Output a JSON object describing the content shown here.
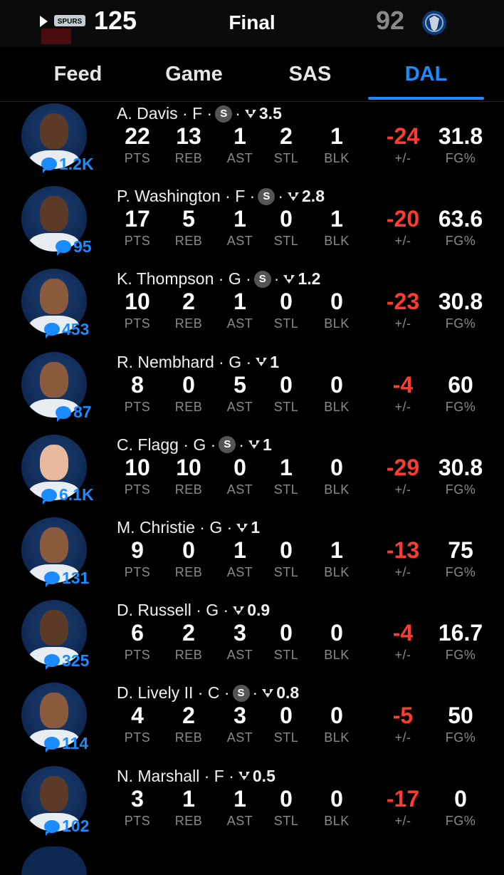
{
  "header": {
    "away_team": "SAS",
    "away_score": "125",
    "status": "Final",
    "home_score": "92",
    "home_team": "DAL",
    "spurs_logo_text": "SPURS"
  },
  "tabs": [
    {
      "label": "Feed",
      "active": false
    },
    {
      "label": "Game",
      "active": false
    },
    {
      "label": "SAS",
      "active": false
    },
    {
      "label": "DAL",
      "active": true
    }
  ],
  "stat_labels": [
    "PTS",
    "REB",
    "AST",
    "STL",
    "BLK",
    "+/-",
    "FG%"
  ],
  "players": [
    {
      "name": "A. Davis",
      "pos": "F",
      "starter": true,
      "rating": "3.5",
      "comments": "1.2K",
      "pts": "22",
      "reb": "13",
      "ast": "1",
      "stl": "2",
      "blk": "1",
      "pm": "-24",
      "fg": "31.8",
      "skin": "dark"
    },
    {
      "name": "P. Washington",
      "pos": "F",
      "starter": true,
      "rating": "2.8",
      "comments": "95",
      "pts": "17",
      "reb": "5",
      "ast": "1",
      "stl": "0",
      "blk": "1",
      "pm": "-20",
      "fg": "63.6",
      "skin": "dark"
    },
    {
      "name": "K. Thompson",
      "pos": "G",
      "starter": true,
      "rating": "1.2",
      "comments": "453",
      "pts": "10",
      "reb": "2",
      "ast": "1",
      "stl": "0",
      "blk": "0",
      "pm": "-23",
      "fg": "30.8",
      "skin": "mid"
    },
    {
      "name": "R. Nembhard",
      "pos": "G",
      "starter": false,
      "rating": "1",
      "comments": "87",
      "pts": "8",
      "reb": "0",
      "ast": "5",
      "stl": "0",
      "blk": "0",
      "pm": "-4",
      "fg": "60",
      "skin": "mid"
    },
    {
      "name": "C. Flagg",
      "pos": "G",
      "starter": true,
      "rating": "1",
      "comments": "6.1K",
      "pts": "10",
      "reb": "10",
      "ast": "0",
      "stl": "1",
      "blk": "0",
      "pm": "-29",
      "fg": "30.8",
      "skin": "light"
    },
    {
      "name": "M. Christie",
      "pos": "G",
      "starter": false,
      "rating": "1",
      "comments": "131",
      "pts": "9",
      "reb": "0",
      "ast": "1",
      "stl": "0",
      "blk": "1",
      "pm": "-13",
      "fg": "75",
      "skin": "mid"
    },
    {
      "name": "D. Russell",
      "pos": "G",
      "starter": false,
      "rating": "0.9",
      "comments": "325",
      "pts": "6",
      "reb": "2",
      "ast": "3",
      "stl": "0",
      "blk": "0",
      "pm": "-4",
      "fg": "16.7",
      "skin": "dark"
    },
    {
      "name": "D. Lively II",
      "pos": "C",
      "starter": true,
      "rating": "0.8",
      "comments": "114",
      "pts": "4",
      "reb": "2",
      "ast": "3",
      "stl": "0",
      "blk": "0",
      "pm": "-5",
      "fg": "50",
      "skin": "mid"
    },
    {
      "name": "N. Marshall",
      "pos": "F",
      "starter": false,
      "rating": "0.5",
      "comments": "102",
      "pts": "3",
      "reb": "1",
      "ast": "1",
      "stl": "0",
      "blk": "0",
      "pm": "-17",
      "fg": "0",
      "skin": "dark"
    }
  ],
  "colors": {
    "accent": "#1a8cff",
    "negative": "#ff3b30",
    "muted": "#8a8a8a"
  }
}
